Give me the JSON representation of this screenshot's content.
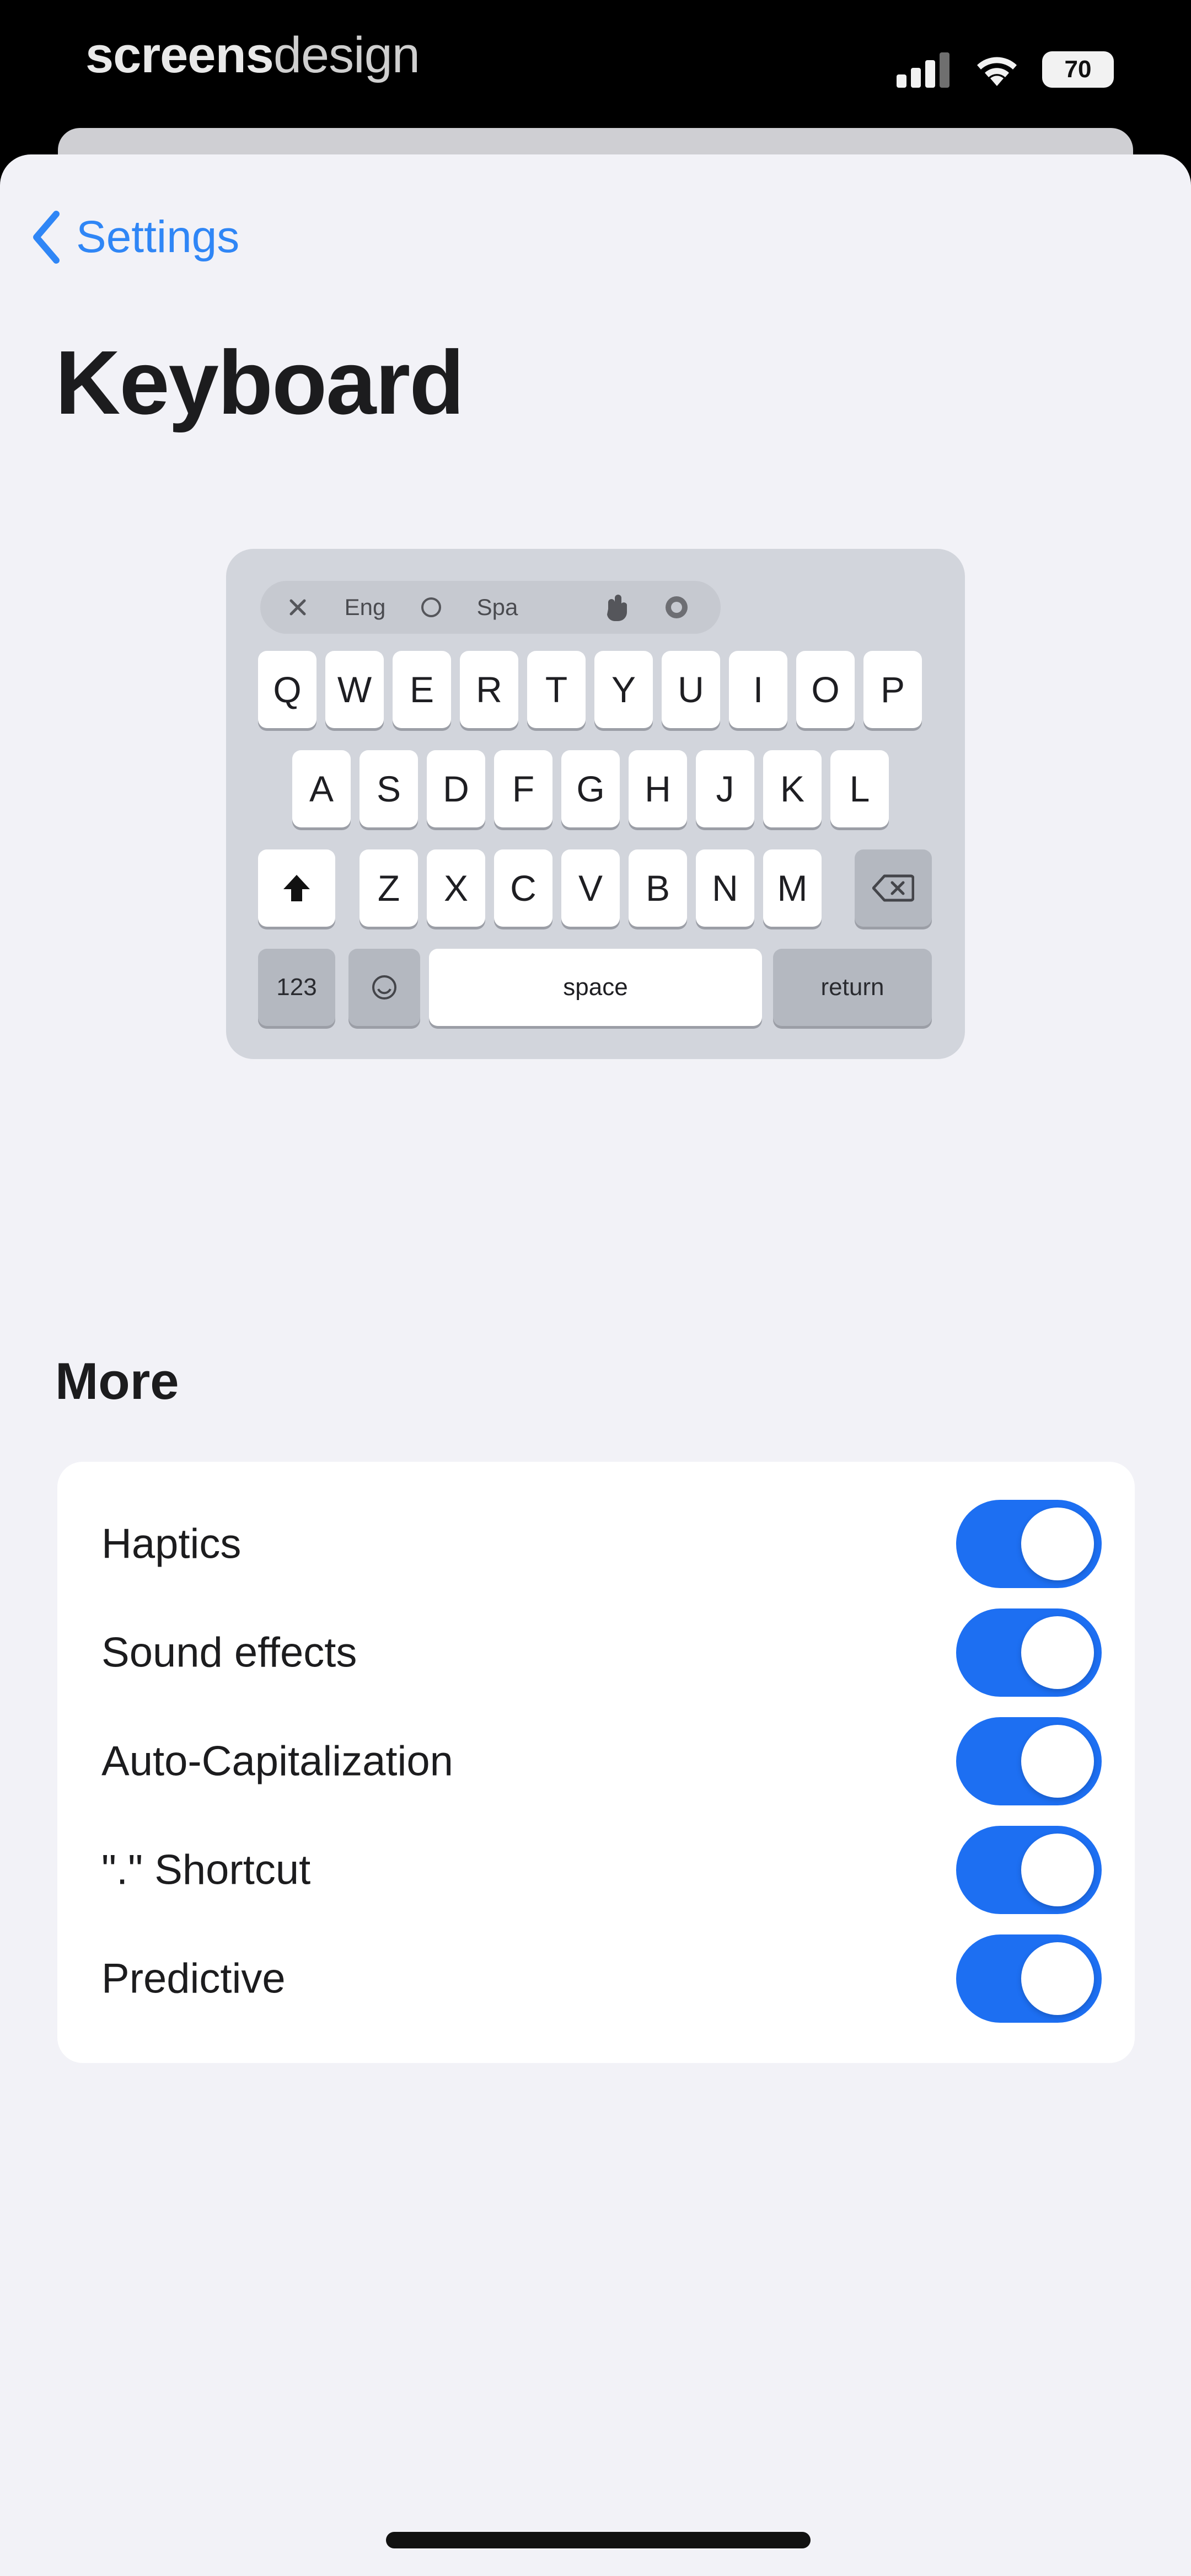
{
  "status_bar": {
    "watermark_bold": "screens",
    "watermark_thin": "design",
    "battery": "70"
  },
  "nav": {
    "back_label": "Settings",
    "title": "Keyboard"
  },
  "keyboard_preview": {
    "toolbar": [
      "Eng",
      "Spa"
    ],
    "row1": [
      "Q",
      "W",
      "E",
      "R",
      "T",
      "Y",
      "U",
      "I",
      "O",
      "P"
    ],
    "row2": [
      "A",
      "S",
      "D",
      "F",
      "G",
      "H",
      "J",
      "K",
      "L"
    ],
    "row3": [
      "Z",
      "X",
      "C",
      "V",
      "B",
      "N",
      "M"
    ],
    "numbers_label": "123",
    "space_label": "space",
    "return_label": "return"
  },
  "more": {
    "title": "More",
    "settings": [
      {
        "label": "Haptics",
        "enabled": true
      },
      {
        "label": "Sound effects",
        "enabled": true
      },
      {
        "label": "Auto-Capitalization",
        "enabled": true
      },
      {
        "label": "\".\" Shortcut",
        "enabled": true
      },
      {
        "label": "Predictive",
        "enabled": true
      }
    ]
  },
  "colors": {
    "accent": "#1d6ff2",
    "link": "#2f86f6",
    "background": "#f2f2f7"
  }
}
